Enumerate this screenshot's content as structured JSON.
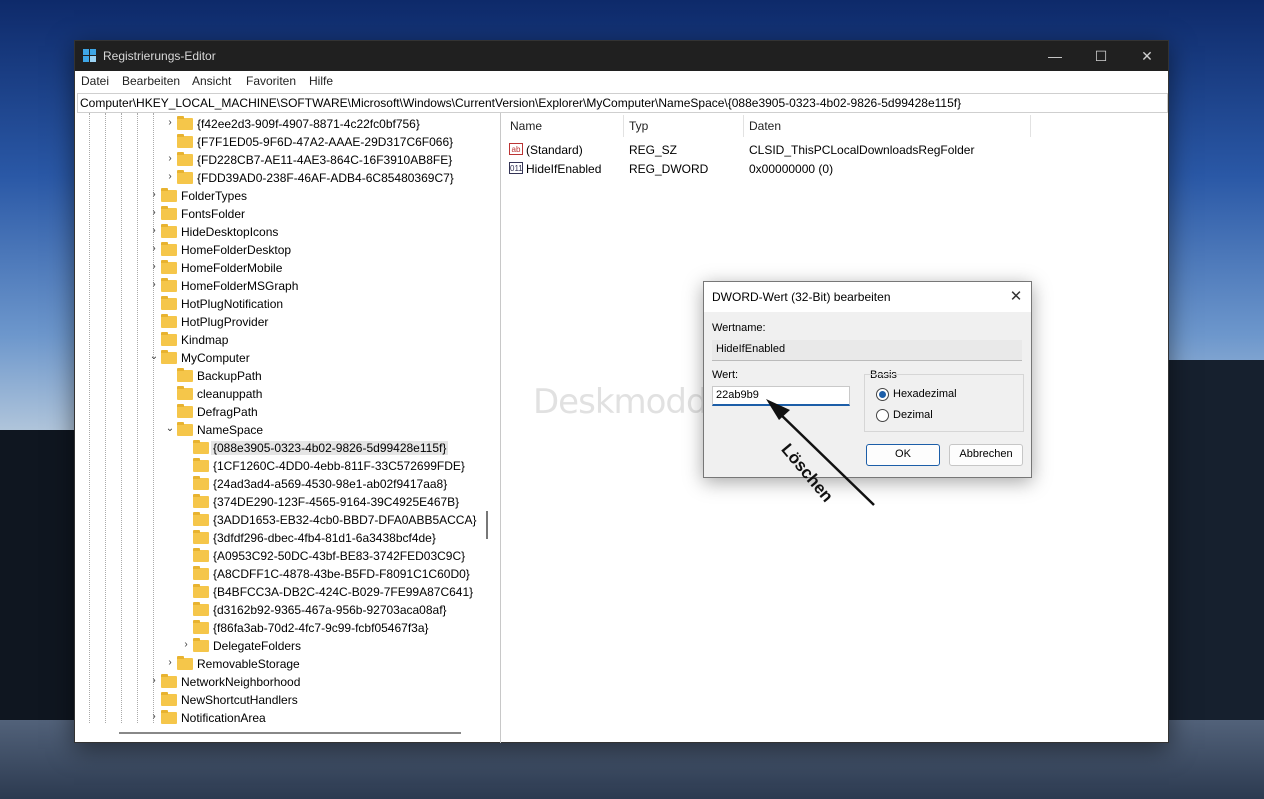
{
  "window": {
    "title": "Registrierungs-Editor",
    "min": "—",
    "max": "☐",
    "close": "✕"
  },
  "menu": [
    "Datei",
    "Bearbeiten",
    "Ansicht",
    "Favoriten",
    "Hilfe"
  ],
  "address": "Computer\\HKEY_LOCAL_MACHINE\\SOFTWARE\\Microsoft\\Windows\\CurrentVersion\\Explorer\\MyComputer\\NameSpace\\{088e3905-0323-4b02-9826-5d99428e115f}",
  "tree": [
    {
      "label": "{f42ee2d3-909f-4907-8871-4c22fc0bf756}",
      "chev": ">"
    },
    {
      "label": "{F7F1ED05-9F6D-47A2-AAAE-29D317C6F066}",
      "chev": ""
    },
    {
      "label": "{FD228CB7-AE11-4AE3-864C-16F3910AB8FE}",
      "chev": ">"
    },
    {
      "label": "{FDD39AD0-238F-46AF-ADB4-6C85480369C7}",
      "chev": ">"
    },
    {
      "label": "FolderTypes",
      "chev": ">"
    },
    {
      "label": "FontsFolder",
      "chev": ">"
    },
    {
      "label": "HideDesktopIcons",
      "chev": ">"
    },
    {
      "label": "HomeFolderDesktop",
      "chev": ">"
    },
    {
      "label": "HomeFolderMobile",
      "chev": ">"
    },
    {
      "label": "HomeFolderMSGraph",
      "chev": ">"
    },
    {
      "label": "HotPlugNotification",
      "chev": ""
    },
    {
      "label": "HotPlugProvider",
      "chev": ""
    },
    {
      "label": "Kindmap",
      "chev": ""
    },
    {
      "label": "MyComputer",
      "chev": "v"
    },
    {
      "label": "BackupPath",
      "chev": ""
    },
    {
      "label": "cleanuppath",
      "chev": ""
    },
    {
      "label": "DefragPath",
      "chev": ""
    },
    {
      "label": "NameSpace",
      "chev": "v"
    },
    {
      "label": "{088e3905-0323-4b02-9826-5d99428e115f}",
      "chev": "",
      "selected": true
    },
    {
      "label": "{1CF1260C-4DD0-4ebb-811F-33C572699FDE}",
      "chev": ""
    },
    {
      "label": "{24ad3ad4-a569-4530-98e1-ab02f9417aa8}",
      "chev": ""
    },
    {
      "label": "{374DE290-123F-4565-9164-39C4925E467B}",
      "chev": ""
    },
    {
      "label": "{3ADD1653-EB32-4cb0-BBD7-DFA0ABB5ACCA}",
      "chev": ""
    },
    {
      "label": "{3dfdf296-dbec-4fb4-81d1-6a3438bcf4de}",
      "chev": ""
    },
    {
      "label": "{A0953C92-50DC-43bf-BE83-3742FED03C9C}",
      "chev": ""
    },
    {
      "label": "{A8CDFF1C-4878-43be-B5FD-F8091C1C60D0}",
      "chev": ""
    },
    {
      "label": "{B4BFCC3A-DB2C-424C-B029-7FE99A87C641}",
      "chev": ""
    },
    {
      "label": "{d3162b92-9365-467a-956b-92703aca08af}",
      "chev": ""
    },
    {
      "label": "{f86fa3ab-70d2-4fc7-9c99-fcbf05467f3a}",
      "chev": ""
    },
    {
      "label": "DelegateFolders",
      "chev": ">"
    },
    {
      "label": "RemovableStorage",
      "chev": ">"
    },
    {
      "label": "NetworkNeighborhood",
      "chev": ">"
    },
    {
      "label": "NewShortcutHandlers",
      "chev": ""
    },
    {
      "label": "NotificationArea",
      "chev": ">"
    }
  ],
  "columns": {
    "name": "Name",
    "type": "Typ",
    "data": "Daten"
  },
  "values": [
    {
      "icon": "ab",
      "name": "(Standard)",
      "type": "REG_SZ",
      "data": "CLSID_ThisPCLocalDownloadsRegFolder"
    },
    {
      "icon": "011",
      "name": "HideIfEnabled",
      "type": "REG_DWORD",
      "data": "0x00000000 (0)"
    }
  ],
  "watermark": "Deskmodder.de",
  "dialog": {
    "title": "DWORD-Wert (32-Bit) bearbeiten",
    "close": "✕",
    "name_label": "Wertname:",
    "name_value": "HideIfEnabled",
    "value_label": "Wert:",
    "value_value": "22ab9b9",
    "basis_label": "Basis",
    "hex_label": "Hexadezimal",
    "dec_label": "Dezimal",
    "ok": "OK",
    "cancel": "Abbrechen"
  },
  "annotation": "Löschen"
}
